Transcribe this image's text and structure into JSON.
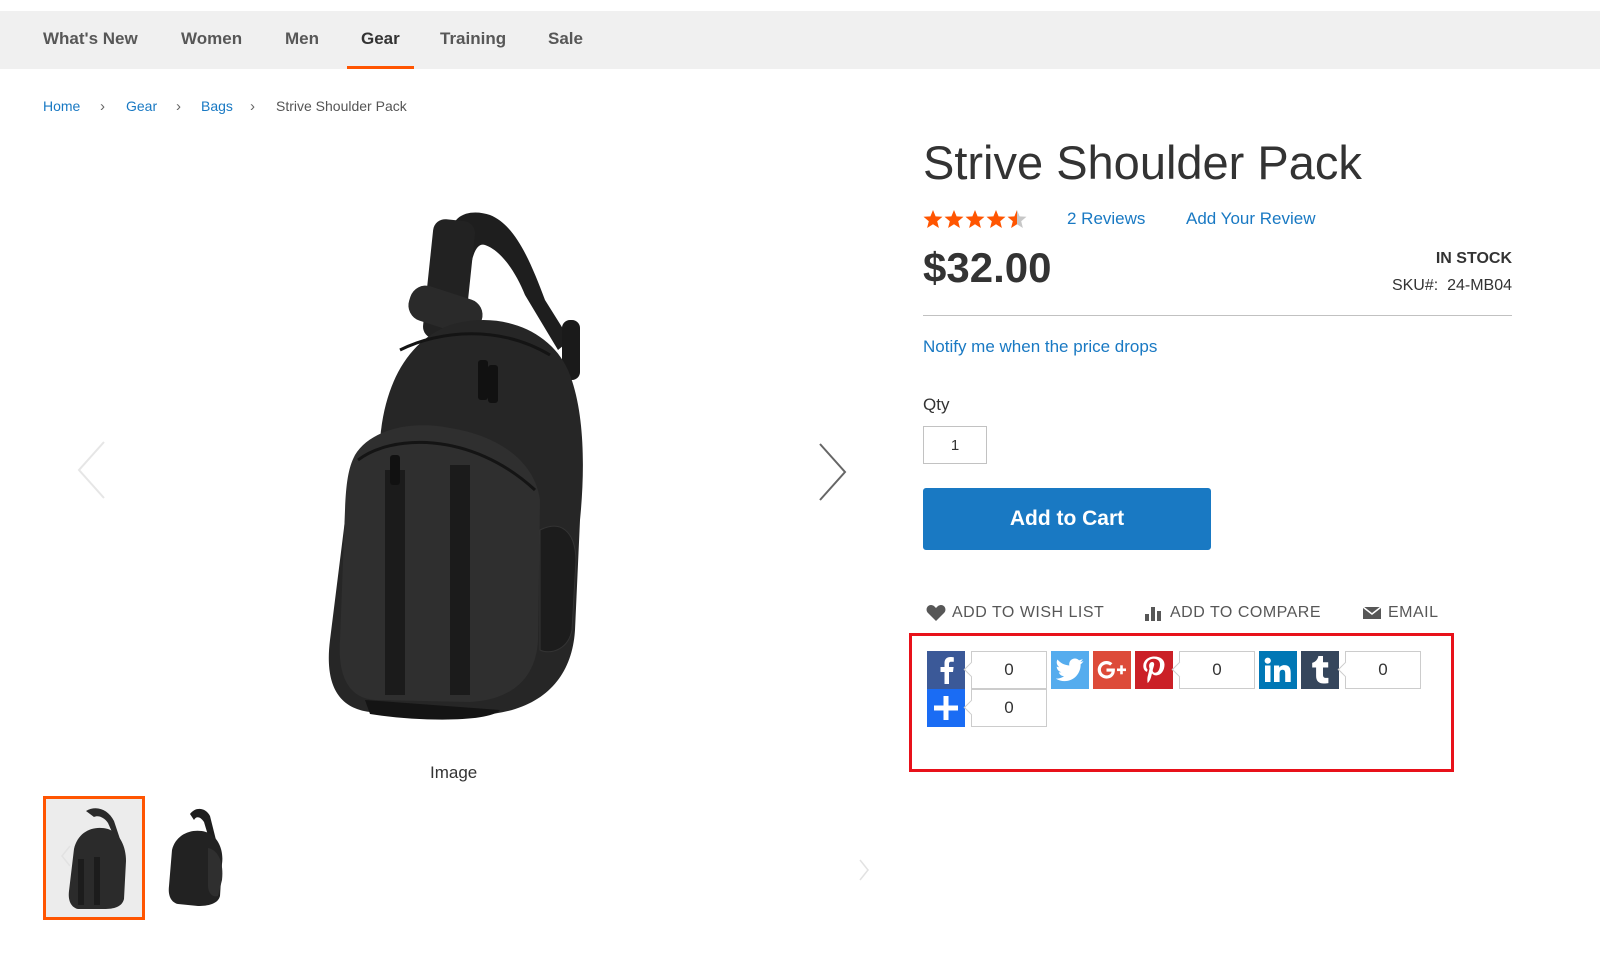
{
  "nav": {
    "items": [
      {
        "label": "What's New"
      },
      {
        "label": "Women"
      },
      {
        "label": "Men"
      },
      {
        "label": "Gear"
      },
      {
        "label": "Training"
      },
      {
        "label": "Sale"
      }
    ],
    "active": "Gear"
  },
  "breadcrumb": {
    "items": [
      "Home",
      "Gear",
      "Bags"
    ],
    "current": "Strive Shoulder Pack",
    "separator": "›"
  },
  "gallery": {
    "caption": "Image",
    "thumbnail_count": 2,
    "active_thumbnail": 1
  },
  "product": {
    "title": "Strive Shoulder Pack",
    "rating": 4.5,
    "rating_max": 5,
    "reviews_label": "2  Reviews",
    "add_review_label": "Add Your Review",
    "price": "$32.00",
    "stock": "IN STOCK",
    "sku_label": "SKU#:",
    "sku_value": "24-MB04",
    "notify_label": "Notify me when the price drops",
    "qty_label": "Qty",
    "qty_value": "1",
    "add_to_cart_label": "Add to Cart"
  },
  "actions": {
    "wishlist": "ADD TO WISH LIST",
    "compare": "ADD TO COMPARE",
    "email": "EMAIL"
  },
  "share": {
    "facebook_count": "0",
    "pinterest_count": "0",
    "tumblr_count": "0",
    "addthis_count": "0"
  },
  "colors": {
    "accent": "#ff5501",
    "link": "#1979c3",
    "button": "#1979c3",
    "highlight_border": "#e8111a",
    "facebook": "#3b5998",
    "twitter": "#55acee",
    "googleplus": "#dd4b39",
    "pinterest": "#cb2027",
    "linkedin": "#0077b5",
    "tumblr": "#35465c",
    "addthis": "#1a6cf4"
  }
}
